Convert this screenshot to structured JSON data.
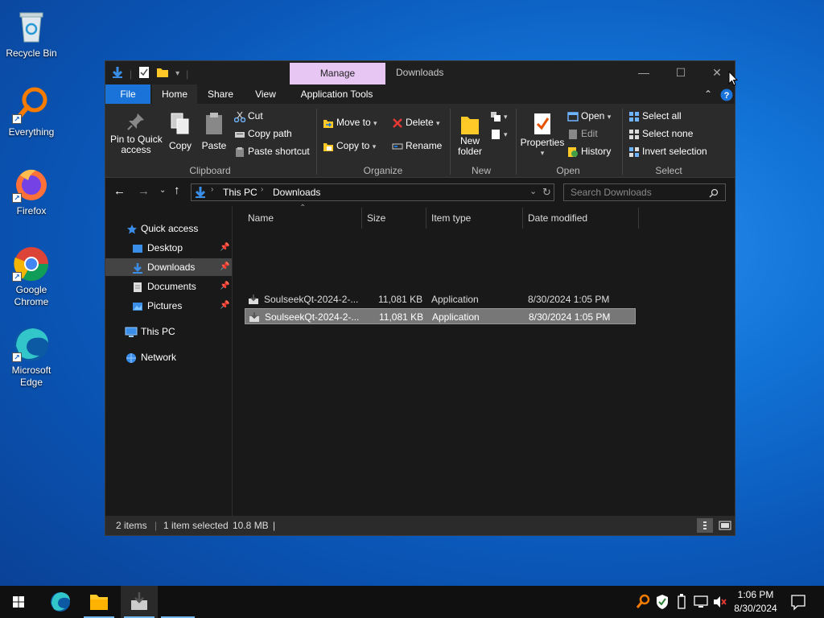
{
  "desktop": {
    "icons": [
      {
        "label": "Recycle Bin"
      },
      {
        "label": "Everything"
      },
      {
        "label": "Firefox"
      },
      {
        "label": "Google Chrome"
      },
      {
        "label": "Microsoft Edge"
      }
    ]
  },
  "window": {
    "manage_tab": "Manage",
    "title": "Downloads",
    "controls": {
      "minimize": "—",
      "maximize": "☐",
      "close": "✕"
    },
    "tabs": {
      "file": "File",
      "home": "Home",
      "share": "Share",
      "view": "View",
      "app_tools": "Application Tools"
    },
    "ribbon": {
      "clipboard": {
        "pin": "Pin to Quick access",
        "pin_l1": "Pin to Quick",
        "pin_l2": "access",
        "copy": "Copy",
        "paste": "Paste",
        "cut": "Cut",
        "copy_path": "Copy path",
        "paste_shortcut": "Paste shortcut",
        "label": "Clipboard"
      },
      "organize": {
        "move_to": "Move to",
        "copy_to": "Copy to",
        "delete": "Delete",
        "rename": "Rename",
        "label": "Organize"
      },
      "new": {
        "new_folder_l1": "New",
        "new_folder_l2": "folder",
        "label": "New"
      },
      "open": {
        "properties": "Properties",
        "open": "Open",
        "edit": "Edit",
        "history": "History",
        "label": "Open"
      },
      "select": {
        "select_all": "Select all",
        "select_none": "Select none",
        "invert": "Invert selection",
        "label": "Select"
      }
    },
    "address": {
      "crumbs": [
        "This PC",
        "Downloads"
      ],
      "search_placeholder": "Search Downloads"
    },
    "nav": {
      "quick_access": "Quick access",
      "desktop": "Desktop",
      "downloads": "Downloads",
      "documents": "Documents",
      "pictures": "Pictures",
      "this_pc": "This PC",
      "network": "Network"
    },
    "columns": {
      "name": "Name",
      "size": "Size",
      "type": "Item type",
      "date": "Date modified"
    },
    "files": [
      {
        "name": "SoulseekQt-2024-2-...",
        "size": "11,081 KB",
        "type": "Application",
        "date": "8/30/2024 1:05 PM",
        "selected": false
      },
      {
        "name": "SoulseekQt-2024-2-...",
        "size": "11,081 KB",
        "type": "Application",
        "date": "8/30/2024 1:05 PM",
        "selected": true
      }
    ],
    "status": {
      "items": "2 items",
      "selected": "1 item selected",
      "size": "10.8 MB"
    }
  },
  "taskbar": {
    "time": "1:06 PM",
    "date": "8/30/2024"
  },
  "colors": {
    "file_tab": "#1a73d9",
    "manage_tab": "#e7c6f3",
    "accent": "#1a73d9"
  }
}
